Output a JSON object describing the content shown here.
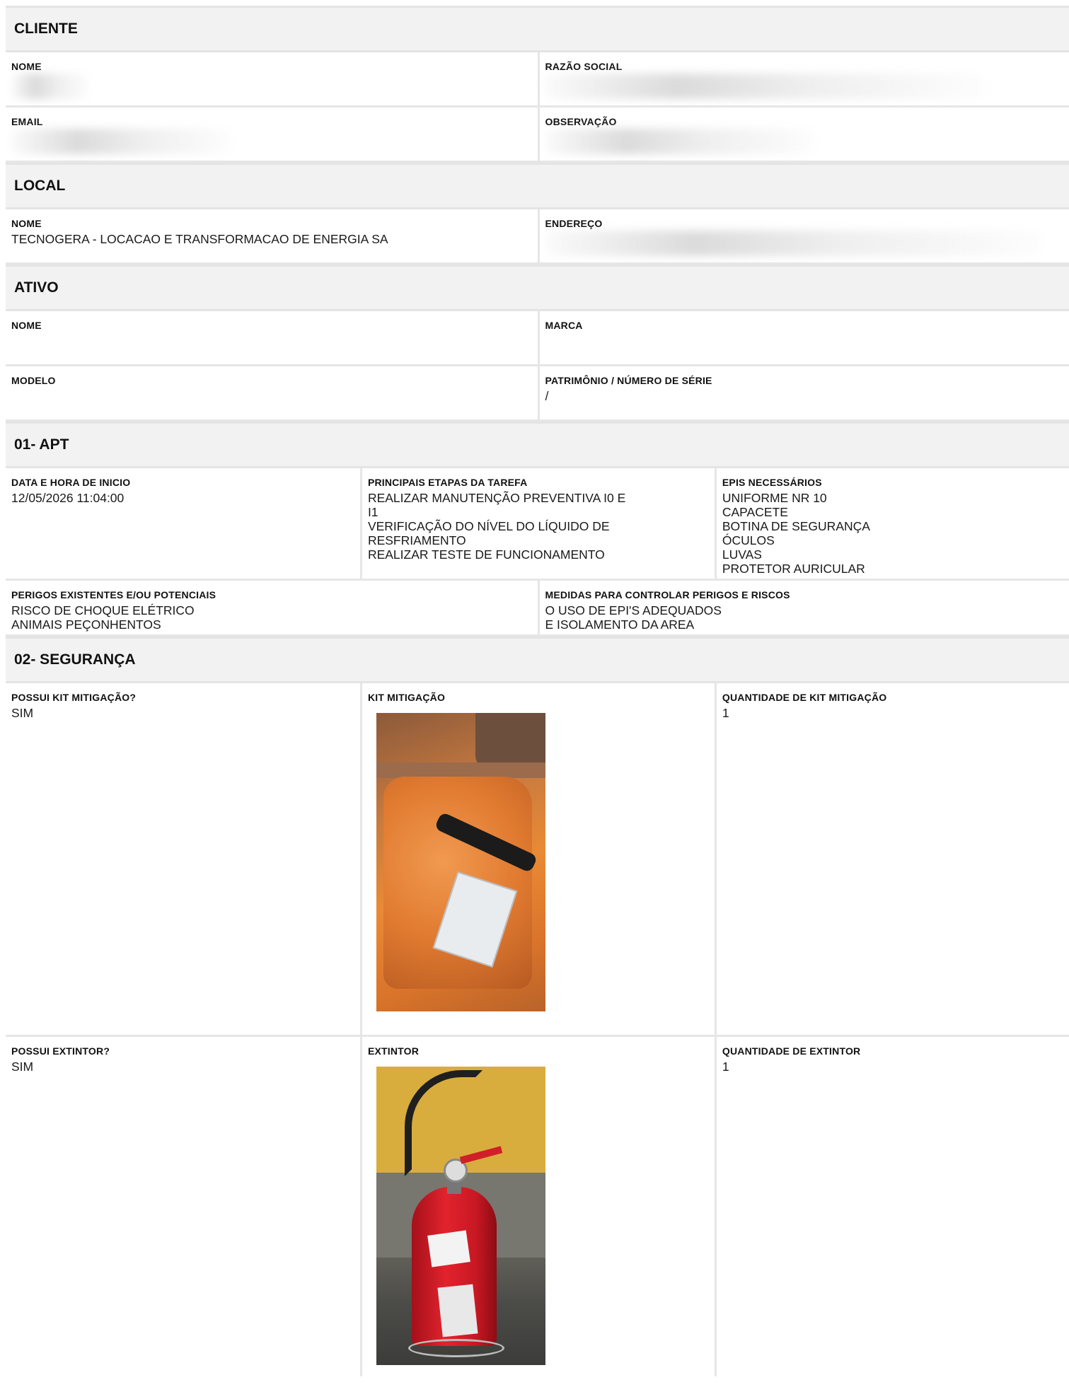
{
  "cliente": {
    "header": "CLIENTE",
    "nome_label": "NOME",
    "razao_label": "RAZÃO SOCIAL",
    "email_label": "EMAIL",
    "obs_label": "OBSERVAÇÃO"
  },
  "local": {
    "header": "LOCAL",
    "nome_label": "NOME",
    "nome_value": "TECNOGERA - LOCACAO E TRANSFORMACAO DE ENERGIA SA",
    "endereco_label": "ENDEREÇO"
  },
  "ativo": {
    "header": "ATIVO",
    "nome_label": "NOME",
    "marca_label": "MARCA",
    "modelo_label": "MODELO",
    "patrimonio_label": "PATRIMÔNIO / NÚMERO DE SÉRIE",
    "patrimonio_value": "/"
  },
  "apt": {
    "header": "01- APT",
    "data_label": "DATA E HORA DE INICIO",
    "data_value": "12/05/2026 11:04:00",
    "etapas_label": "PRINCIPAIS ETAPAS DA TAREFA",
    "etapas_value": "REALIZAR MANUTENÇÃO PREVENTIVA I0 E I1\nVERIFICAÇÃO DO NÍVEL DO LÍQUIDO DE RESFRIAMENTO\nREALIZAR TESTE DE FUNCIONAMENTO",
    "epis_label": "EPIS NECESSÁRIOS",
    "epis_value": "UNIFORME NR 10\nCAPACETE\nBOTINA DE SEGURANÇA\nÓCULOS\nLUVAS\nPROTETOR AURICULAR",
    "perigos_label": "PERIGOS EXISTENTES E/OU POTENCIAIS",
    "perigos_value": "RISCO DE CHOQUE ELÉTRICO\nANIMAIS PEÇONHENTOS",
    "medidas_label": "MEDIDAS PARA CONTROLAR PERIGOS E RISCOS",
    "medidas_value": "O USO DE EPI'S ADEQUADOS\nE ISOLAMENTO DA AREA"
  },
  "seguranca": {
    "header": "02- SEGURANÇA",
    "kit_possui_label": "POSSUI KIT MITIGAÇÃO?",
    "kit_possui_value": "SIM",
    "kit_label": "KIT MITIGAÇÃO",
    "kit_qtd_label": "QUANTIDADE DE KIT MITIGAÇÃO",
    "kit_qtd_value": "1",
    "ext_possui_label": "POSSUI EXTINTOR?",
    "ext_possui_value": "SIM",
    "ext_label": "EXTINTOR",
    "ext_qtd_label": "QUANTIDADE DE EXTINTOR",
    "ext_qtd_value": "1"
  }
}
